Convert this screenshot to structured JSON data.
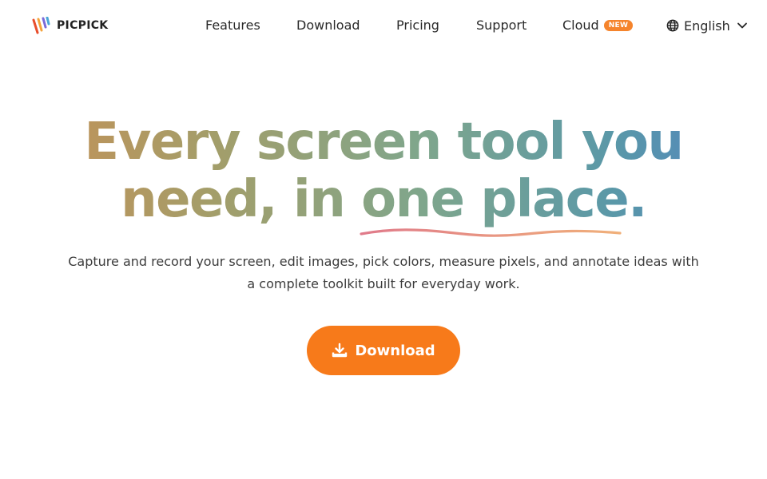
{
  "brand": {
    "name": "PICPICK",
    "logo_icon": "striped-p-logo-icon"
  },
  "nav": {
    "items": [
      {
        "label": "Features"
      },
      {
        "label": "Download"
      },
      {
        "label": "Pricing"
      },
      {
        "label": "Support"
      },
      {
        "label": "Cloud",
        "badge": "NEW"
      }
    ],
    "language": {
      "label": "English",
      "icon": "globe-icon",
      "dropdown_icon": "chevron-down-icon"
    }
  },
  "hero": {
    "headline_line1": "Every screen tool you",
    "headline_line2": "need, in one place.",
    "subtext": "Capture and record your screen, edit images, pick colors, measure pixels, and annotate ideas with a complete toolkit built for everyday work.",
    "cta_label": "Download",
    "cta_icon": "download-icon"
  },
  "colors": {
    "accent_orange": "#f77a1a",
    "badge_orange": "#f5842c",
    "gradient_start": "#c98f54",
    "gradient_mid": "#7fa68c",
    "gradient_end": "#4f82c4",
    "underline": "#e8907a"
  }
}
